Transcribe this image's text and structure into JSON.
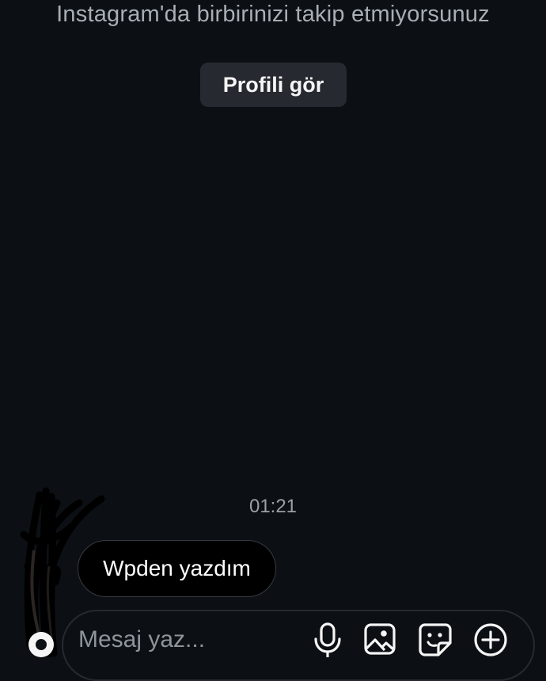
{
  "thread": {
    "follow_notice": "Instagram'da birbirinizi takip etmiyorsunuz",
    "view_profile_label": "Profili gör"
  },
  "messages": [
    {
      "time": "01:21",
      "text": "Wpden yazdım",
      "direction": "incoming"
    }
  ],
  "composer": {
    "placeholder": "Mesaj yaz...",
    "icons": [
      "microphone-icon",
      "image-icon",
      "sticker-icon",
      "add-icon"
    ]
  },
  "colors": {
    "background": "#0c1014",
    "button_bg": "#262a30",
    "bubble_bg": "#000000",
    "muted_text": "#a8aeb5"
  }
}
